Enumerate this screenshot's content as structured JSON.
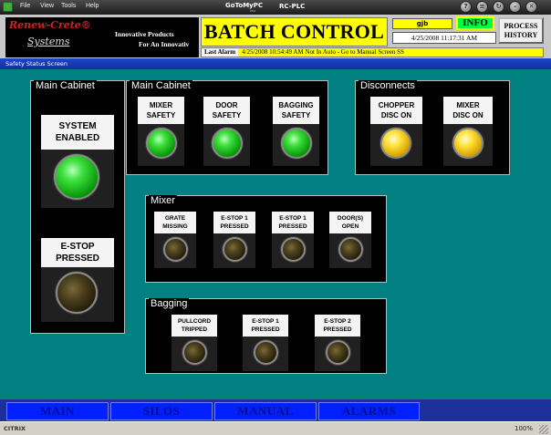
{
  "window": {
    "menu": [
      "File",
      "View",
      "Tools",
      "Help"
    ],
    "brand": "GoToMyPC",
    "brand_sub": "PRO",
    "title": "RC-PLC",
    "buttons": [
      "?",
      "≡",
      "↻",
      "–",
      "✕"
    ]
  },
  "header": {
    "logo_name": "Renew-Crete®",
    "logo_systems": "Systems",
    "tagline_1": "Innovative Products",
    "tagline_2": "For An Innovativ",
    "title": "BATCH CONTROL",
    "user": "gjb",
    "info_label": "INFO",
    "datetime": "4/25/2008  11:17:31 AM",
    "process_history_line1": "PROCESS",
    "process_history_line2": "HISTORY",
    "last_alarm_label": "Last Alarm",
    "last_alarm_text": "4/25/2008  10:54:49 AM     Not In Auto - Go to Manual Screen SS"
  },
  "screen_title": "Safety Status Screen",
  "panels": {
    "main_cabinet_left": "Main Cabinet",
    "main_cabinet_right": "Main Cabinet",
    "disconnects": "Disconnects",
    "mixer": "Mixer",
    "bagging": "Bagging"
  },
  "indicators": {
    "system_enabled": {
      "line1": "SYSTEM",
      "line2": "ENABLED",
      "state": "green"
    },
    "estop_pressed": {
      "line1": "E-STOP",
      "line2": "PRESSED",
      "state": "off"
    },
    "mixer_safety": {
      "line1": "MIXER",
      "line2": "SAFETY",
      "state": "green"
    },
    "door_safety": {
      "line1": "DOOR",
      "line2": "SAFETY",
      "state": "green"
    },
    "bagging_safety": {
      "line1": "BAGGING",
      "line2": "SAFETY",
      "state": "green"
    },
    "chopper_disc_on": {
      "line1": "CHOPPER",
      "line2": "DISC ON",
      "state": "yellow"
    },
    "mixer_disc_on": {
      "line1": "MIXER",
      "line2": "DISC ON",
      "state": "yellow"
    },
    "grate_missing": {
      "line1": "GRATE",
      "line2": "MISSING",
      "state": "off"
    },
    "mixer_estop1": {
      "line1": "E-STOP 1",
      "line2": "PRESSED",
      "state": "off"
    },
    "mixer_estop1b": {
      "line1": "E-STOP 1",
      "line2": "PRESSED",
      "state": "off"
    },
    "doors_open": {
      "line1": "DOOR(S)",
      "line2": "OPEN",
      "state": "off"
    },
    "pullcord_tripped": {
      "line1": "PULLCORD",
      "line2": "TRIPPED",
      "state": "off"
    },
    "bagging_estop1": {
      "line1": "E-STOP 1",
      "line2": "PRESSED",
      "state": "off"
    },
    "bagging_estop2": {
      "line1": "E-STOP 2",
      "line2": "PRESSED",
      "state": "off"
    }
  },
  "nav": [
    "MAIN",
    "SILOS",
    "MANUAL",
    "ALARMS"
  ],
  "status": {
    "citrix": "CITRIX",
    "zoom": "100%"
  },
  "colors": {
    "background": "#008080",
    "header_yellow": "#ffff00",
    "nav_blue": "#0020ff",
    "lamp_green": "#3de03d",
    "lamp_yellow": "#ffe23a"
  }
}
